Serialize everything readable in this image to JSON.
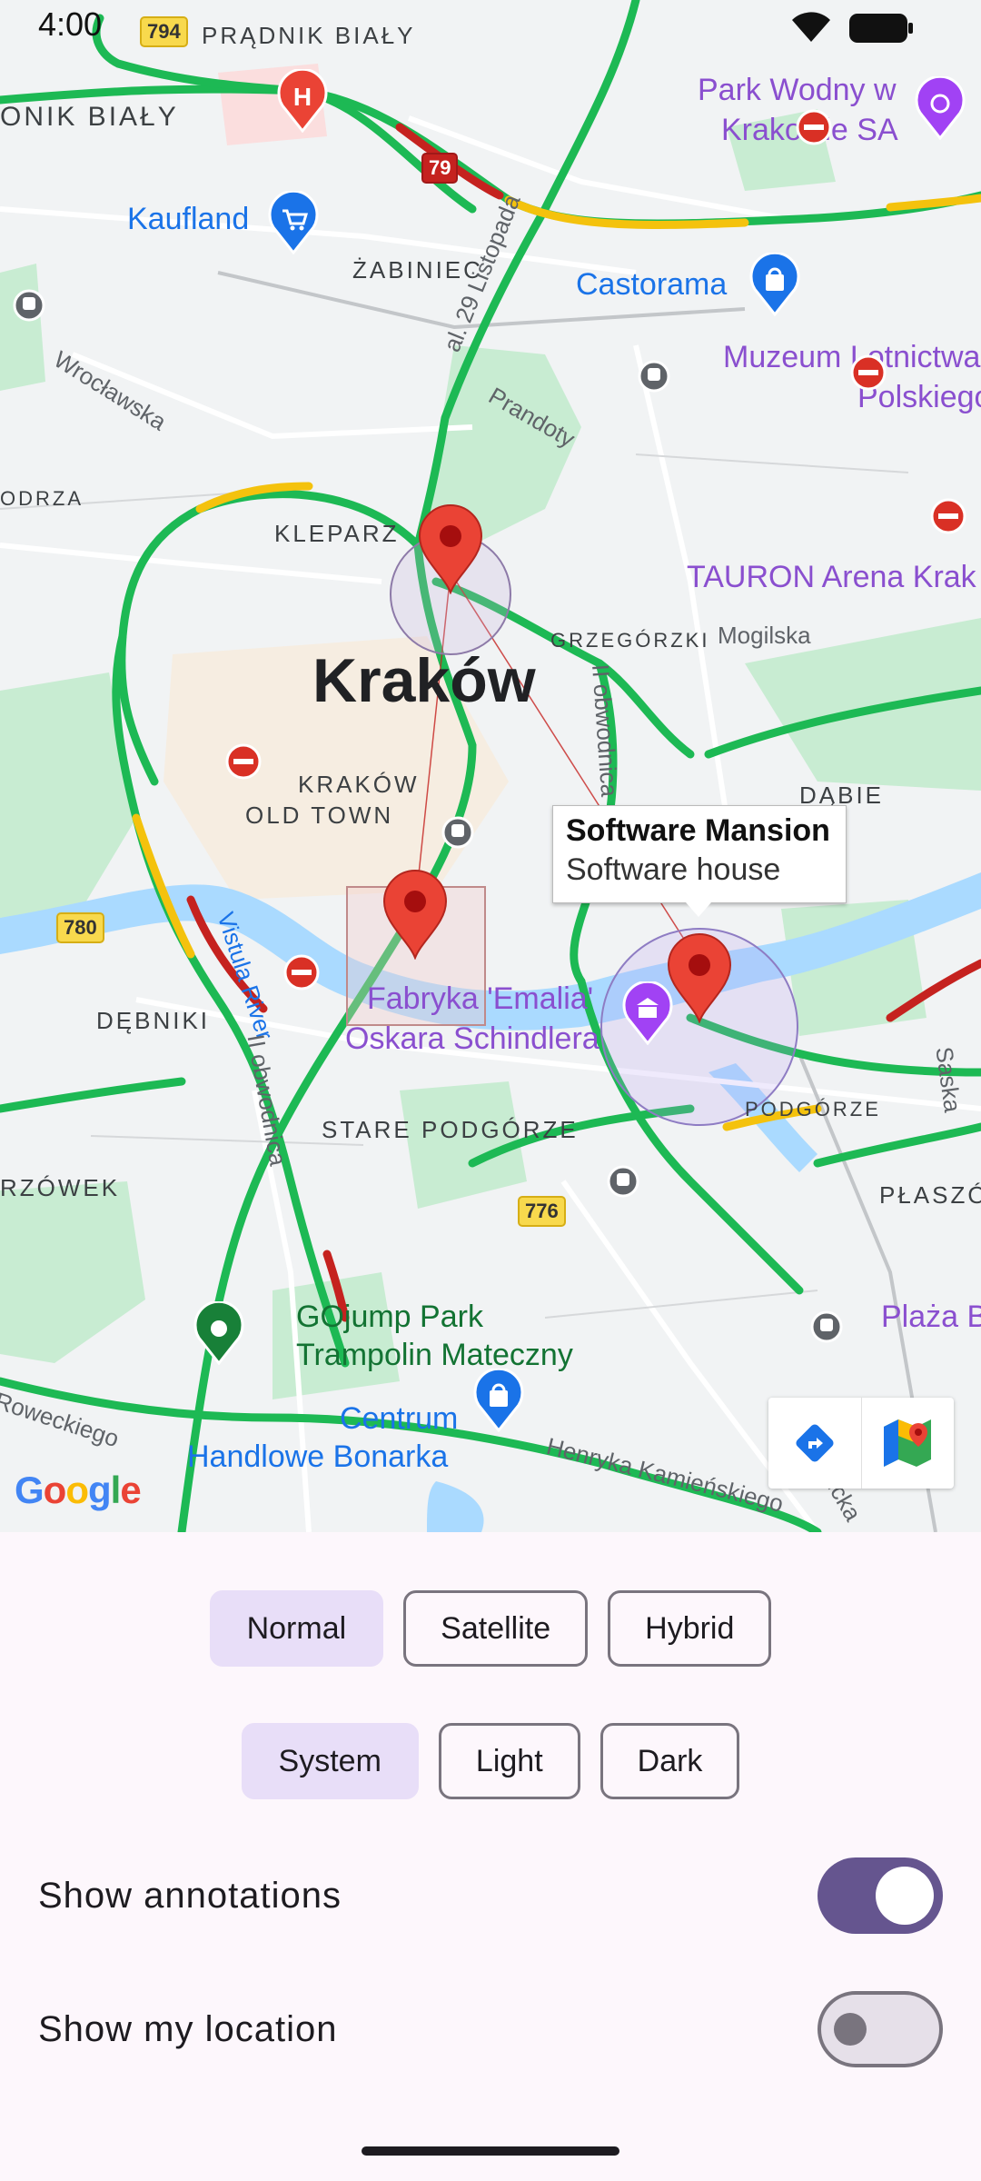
{
  "status_bar": {
    "time": "4:00"
  },
  "map": {
    "city": "Kraków",
    "districts": [
      "PRĄDNIK BIAŁY",
      "ONIK BIAŁY",
      "ŻABINIEC",
      "KLEPARZ",
      "GRZEGÓRZKI",
      "KRAKÓW",
      "OLD TOWN",
      "DĄBIE",
      "DĘBNIKI",
      "STARE PODGÓRZE",
      "PODGÓRZE",
      "PŁASZÓ",
      "RZÓWEK",
      "ODRZA"
    ],
    "streets": [
      "al. 29 Listopada",
      "Wrocławska",
      "Prandoty",
      "Mogilska",
      "II obwodnica",
      "Vistula River",
      "II obwodnica",
      "Saska",
      "Henryka Kamieńskiego",
      "Roweckiego",
      "Wielicka"
    ],
    "pois": {
      "kaufland": "Kaufland",
      "castorama": "Castorama",
      "park_wodny_1": "Park Wodny w",
      "park_wodny_2": "Krakowie SA",
      "muzeum_1": "Muzeum Lotnictwa",
      "muzeum_2": "Polskiego",
      "tauron": "TAURON Arena Krak",
      "fabryka_1": "Fabryka 'Emalia'",
      "fabryka_2": "Oskara Schindlera",
      "gojump_1": "GOjump Park",
      "gojump_2": "Trampolin Mateczny",
      "centrum_1": "Centrum",
      "centrum_2": "Handlowe Bonarka",
      "plaza": "Plaża B"
    },
    "route_shields": {
      "r794": "794",
      "r79": "79",
      "r780": "780",
      "r776": "776"
    },
    "callout": {
      "title": "Software Mansion",
      "subtitle": "Software house"
    },
    "google_logo": "Google"
  },
  "map_type": {
    "options": [
      "Normal",
      "Satellite",
      "Hybrid"
    ],
    "selected": "Normal"
  },
  "theme": {
    "options": [
      "System",
      "Light",
      "Dark"
    ],
    "selected": "System"
  },
  "toggles": {
    "show_annotations": {
      "label": "Show annotations",
      "on": true
    },
    "show_my_location": {
      "label": "Show my location",
      "on": false
    }
  },
  "colors": {
    "accent": "#65558f",
    "selected_chip": "#e8def8",
    "traffic_green": "#1db954",
    "traffic_yellow": "#f4c20d",
    "traffic_red": "#c5221f",
    "water": "#aadaff",
    "marker": "#ea4335"
  }
}
